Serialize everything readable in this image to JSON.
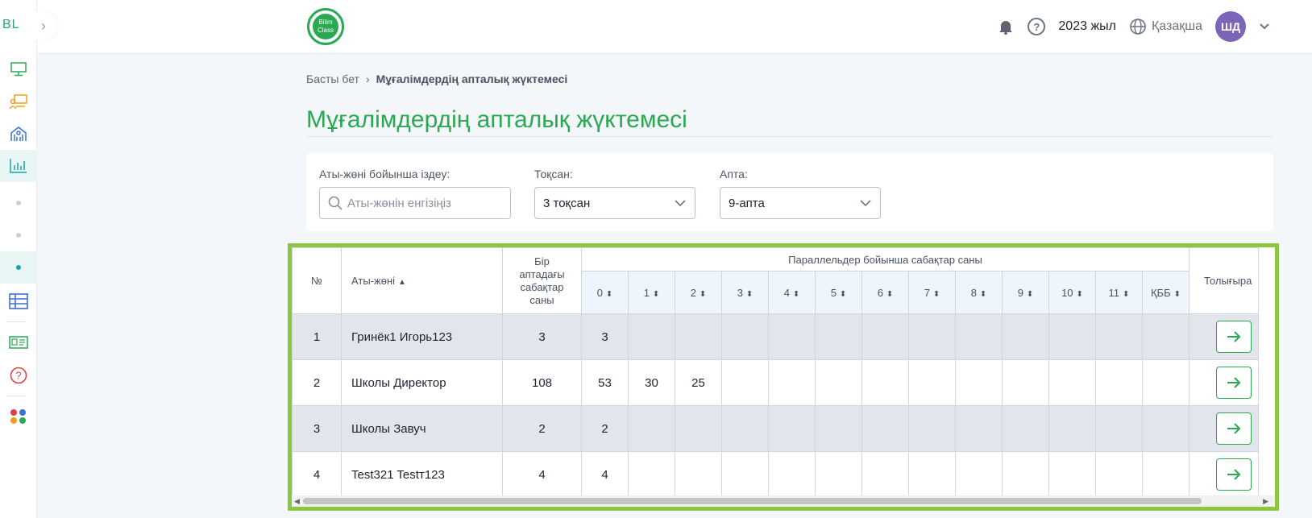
{
  "sidebar": {
    "logo": "BL",
    "collapse_icon": "chevron-right-icon",
    "items": [
      {
        "icon": "monitor-icon",
        "color": "#2aa852"
      },
      {
        "icon": "presentation-icon",
        "color": "#f0a020"
      },
      {
        "icon": "school-icon",
        "color": "#3d6fd6"
      },
      {
        "icon": "chart-icon",
        "color": "#16a6a8",
        "active": true
      },
      {
        "icon": "dot-icon"
      },
      {
        "icon": "dot-icon"
      },
      {
        "icon": "dot-icon",
        "active": true
      },
      {
        "icon": "table-icon",
        "color": "#3d6fd6"
      },
      {
        "icon": "id-card-icon",
        "color": "#2aa852"
      },
      {
        "icon": "help-icon",
        "color": "#e04040"
      },
      {
        "icon": "apps-icon"
      }
    ]
  },
  "topbar": {
    "brand_line1": "Bilim",
    "brand_line2": "Class",
    "year": "2023 жыл",
    "language": "Қазақша",
    "avatar_initials": "ШД"
  },
  "breadcrumb": {
    "home": "Басты бет",
    "current": "Мұғалімдердің апталық жүктемесі"
  },
  "page_title": "Мұғалімдердің апталық жүктемесі",
  "filters": {
    "search_label": "Аты-жөні бойынша іздеу:",
    "search_placeholder": "Аты-жөнін енгізіңіз",
    "quarter_label": "Тоқсан:",
    "quarter_value": "3 тоқсан",
    "week_label": "Апта:",
    "week_value": "9-апта"
  },
  "table": {
    "col_num": "№",
    "col_name": "Аты-жөні",
    "col_weekly": "Бір аптадағы сабақтар саны",
    "col_parallels": "Параллельдер бойынша сабақтар саны",
    "col_fill": "Толығыра",
    "parallels": [
      "0",
      "1",
      "2",
      "3",
      "4",
      "5",
      "6",
      "7",
      "8",
      "9",
      "10",
      "11",
      "ҚББ"
    ],
    "rows": [
      {
        "num": "1",
        "name": "Гринёк1 Игорь123",
        "weekly": "3",
        "p": [
          "3",
          "",
          "",
          "",
          "",
          "",
          "",
          "",
          "",
          "",
          "",
          "",
          ""
        ]
      },
      {
        "num": "2",
        "name": "Школы Директор",
        "weekly": "108",
        "p": [
          "53",
          "30",
          "25",
          "",
          "",
          "",
          "",
          "",
          "",
          "",
          "",
          "",
          ""
        ]
      },
      {
        "num": "3",
        "name": "Школы Завуч",
        "weekly": "2",
        "p": [
          "2",
          "",
          "",
          "",
          "",
          "",
          "",
          "",
          "",
          "",
          "",
          "",
          ""
        ]
      },
      {
        "num": "4",
        "name": "Test321 Testт123",
        "weekly": "4",
        "p": [
          "4",
          "",
          "",
          "",
          "",
          "",
          "",
          "",
          "",
          "",
          "",
          "",
          ""
        ]
      }
    ]
  },
  "colors": {
    "accent": "#2aa852",
    "highlight_frame": "#8dc63f",
    "avatar": "#7b65b8"
  }
}
